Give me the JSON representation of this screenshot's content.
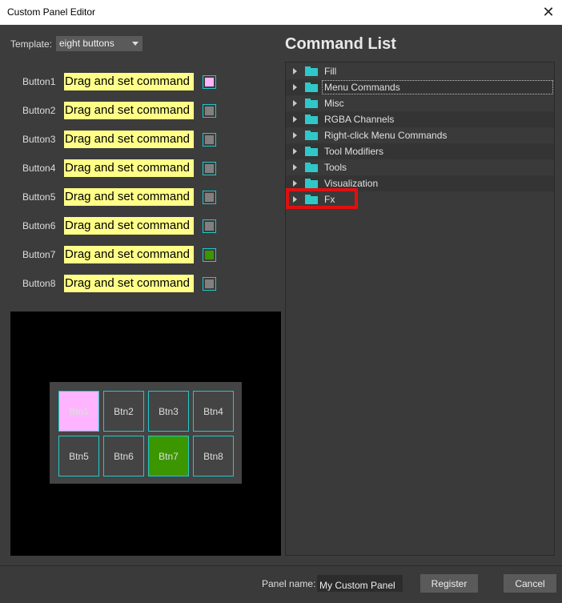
{
  "window": {
    "title": "Custom Panel Editor",
    "close_glyph": "✕"
  },
  "template": {
    "label": "Template:",
    "value": "eight buttons"
  },
  "buttons": [
    {
      "label": "Button1",
      "command": "Drag and set command",
      "color": "#ffb4ff"
    },
    {
      "label": "Button2",
      "command": "Drag and set command",
      "color": "#808080"
    },
    {
      "label": "Button3",
      "command": "Drag and set command",
      "color": "#808080"
    },
    {
      "label": "Button4",
      "command": "Drag and set command",
      "color": "#808080"
    },
    {
      "label": "Button5",
      "command": "Drag and set command",
      "color": "#808080"
    },
    {
      "label": "Button6",
      "command": "Drag and set command",
      "color": "#808080"
    },
    {
      "label": "Button7",
      "command": "Drag and set command",
      "color": "#3c9600"
    },
    {
      "label": "Button8",
      "command": "Drag and set command",
      "color": "#808080"
    }
  ],
  "preview": {
    "buttons": [
      {
        "label": "Btn1",
        "color": "#ffb4ff"
      },
      {
        "label": "Btn2",
        "color": "#444444"
      },
      {
        "label": "Btn3",
        "color": "#444444"
      },
      {
        "label": "Btn4",
        "color": "#444444"
      },
      {
        "label": "Btn5",
        "color": "#444444"
      },
      {
        "label": "Btn6",
        "color": "#444444"
      },
      {
        "label": "Btn7",
        "color": "#3c9600"
      },
      {
        "label": "Btn8",
        "color": "#444444"
      }
    ]
  },
  "command_list": {
    "title": "Command List",
    "folders": [
      "Fill",
      "Menu Commands",
      "Misc",
      "RGBA Channels",
      "Right-click Menu Commands",
      "Tool Modifiers",
      "Tools",
      "Visualization",
      "Fx"
    ],
    "selected": "Menu Commands",
    "highlighted": "Fx"
  },
  "footer": {
    "panel_name_label": "Panel name:",
    "panel_name_value": "My Custom Panel",
    "register_label": "Register",
    "cancel_label": "Cancel"
  },
  "colors": {
    "accent_cyan": "#22c8c8",
    "highlight_red": "#e01010",
    "command_field": "#ffff88"
  }
}
